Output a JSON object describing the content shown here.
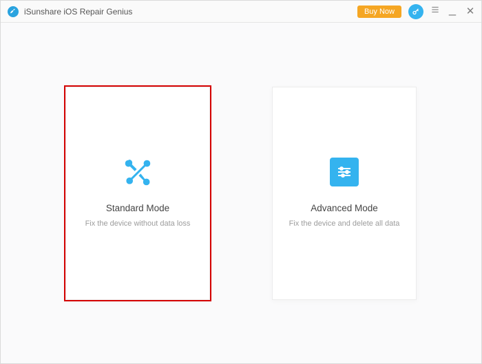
{
  "titlebar": {
    "app_title": "iSunshare iOS Repair Genius",
    "buy_label": "Buy Now"
  },
  "main": {
    "cards": [
      {
        "icon_name": "tools-icon",
        "title": "Standard Mode",
        "description": "Fix the device without data loss",
        "selected": true
      },
      {
        "icon_name": "sliders-icon",
        "title": "Advanced Mode",
        "description": "Fix the device and delete all data",
        "selected": false
      }
    ]
  }
}
